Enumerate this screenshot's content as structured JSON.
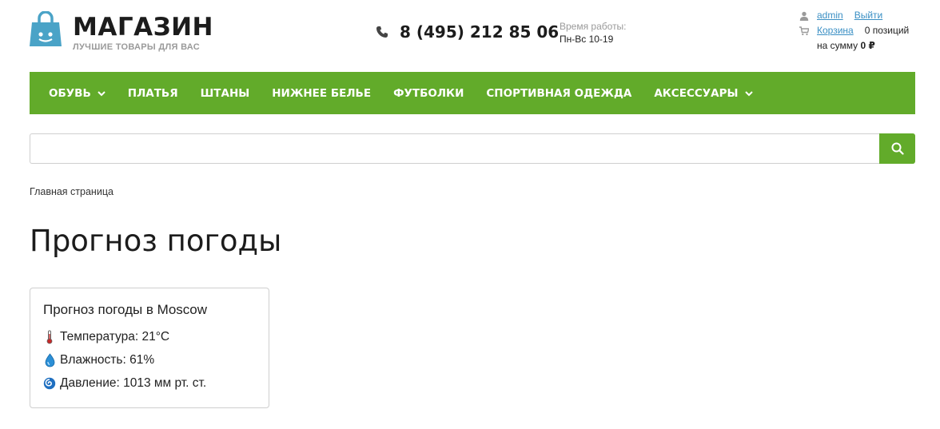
{
  "header": {
    "logo_title": "МАГАЗИН",
    "logo_subtitle": "ЛУЧШИЕ ТОВАРЫ ДЛЯ ВАС",
    "phone": "8 (495) 212 85 06",
    "hours_label": "Время работы:",
    "hours_value": "Пн-Вс 10-19",
    "user": {
      "username": "admin",
      "logout": "Выйти",
      "cart_label": "Корзина",
      "cart_count": "0 позиций",
      "sum_prefix": "на сумму",
      "sum_value": "0 ₽"
    }
  },
  "nav": {
    "items": [
      {
        "label": "ОБУВЬ",
        "dropdown": true
      },
      {
        "label": "ПЛАТЬЯ",
        "dropdown": false
      },
      {
        "label": "ШТАНЫ",
        "dropdown": false
      },
      {
        "label": "НИЖНЕЕ БЕЛЬЕ",
        "dropdown": false
      },
      {
        "label": "ФУТБОЛКИ",
        "dropdown": false
      },
      {
        "label": "СПОРТИВНАЯ ОДЕЖДА",
        "dropdown": false
      },
      {
        "label": "АКСЕССУАРЫ",
        "dropdown": true
      }
    ]
  },
  "search": {
    "value": "",
    "placeholder": "",
    "icon": "search-icon"
  },
  "breadcrumb": "Главная страница",
  "page_title": "Прогноз погоды",
  "weather": {
    "title": "Прогноз погоды в Moscow",
    "temperature": "Температура: 21°C",
    "humidity": "Влажность: 61%",
    "pressure": "Давление: 1013 мм рт. ст."
  },
  "colors": {
    "accent": "#62ab2a",
    "logo": "#4aa3c7",
    "link": "#3a8fc4"
  }
}
